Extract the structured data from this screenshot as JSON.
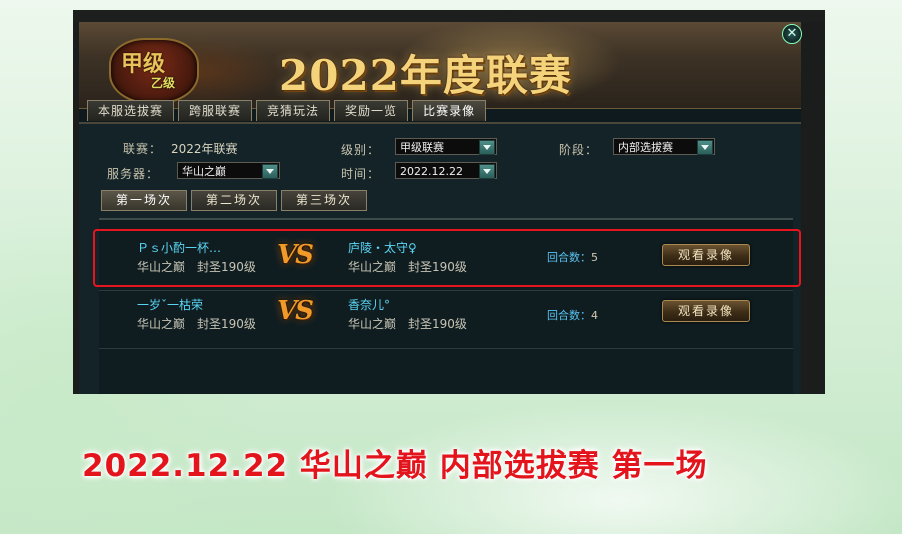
{
  "banner": {
    "logo_main": "甲级",
    "logo_sub": "乙级",
    "title": "2022年度联赛",
    "close_symbol": "✕"
  },
  "tabs": [
    {
      "label": "本服选拔赛",
      "active": false
    },
    {
      "label": "跨服联赛",
      "active": false
    },
    {
      "label": "竞猜玩法",
      "active": false
    },
    {
      "label": "奖励一览",
      "active": false
    },
    {
      "label": "比赛录像",
      "active": true
    }
  ],
  "filters": {
    "league_label": "联赛：",
    "league_value": "2022年联赛",
    "level_label": "级别：",
    "level_value": "甲级联赛",
    "stage_label": "阶段：",
    "stage_value": "内部选拔赛",
    "server_label": "服务器：",
    "server_value": "华山之巅",
    "time_label": "时间：",
    "time_value": "2022.12.22"
  },
  "sub_tabs": [
    {
      "label": "第一场次",
      "active": true
    },
    {
      "label": "第二场次",
      "active": false
    },
    {
      "label": "第三场次",
      "active": false
    }
  ],
  "matches": [
    {
      "left_name": "Ｐｓ小酌一杯…",
      "left_info": "华山之巅　封圣190级",
      "vs": "VS",
      "right_name": "庐陵・太守♀",
      "right_info": "华山之巅　封圣190级",
      "rounds_label": "回合数：",
      "rounds_value": "5",
      "watch_label": "观看录像",
      "highlighted": true
    },
    {
      "left_name": "一岁ˇ一枯荣",
      "left_info": "华山之巅　封圣190级",
      "vs": "VS",
      "right_name": "香奈儿°",
      "right_info": "华山之巅　封圣190级",
      "rounds_label": "回合数：",
      "rounds_value": "4",
      "watch_label": "观看录像",
      "highlighted": false
    }
  ],
  "caption": "2022.12.22 华山之巅 内部选拔赛 第一场",
  "colors": {
    "highlight_border": "#e8141e",
    "caption": "#e3141c",
    "player_name": "#5bd6f5",
    "vs": "#f09a2a"
  }
}
